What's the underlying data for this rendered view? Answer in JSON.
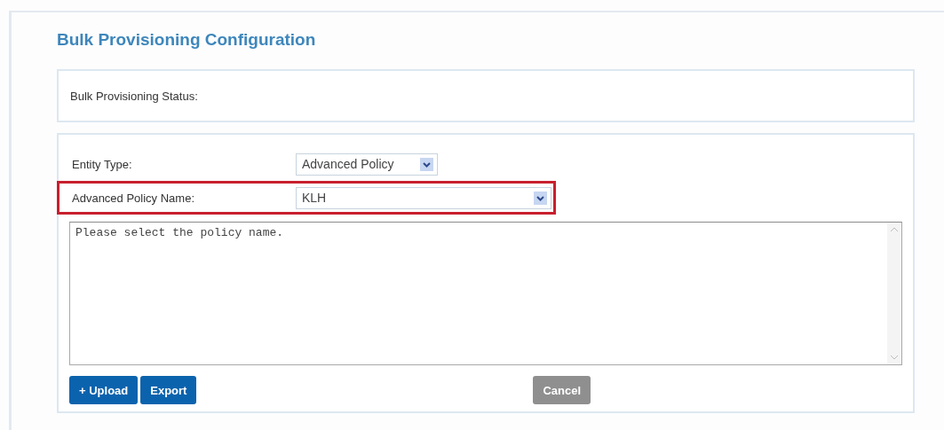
{
  "title": "Bulk Provisioning Configuration",
  "status": {
    "label": "Bulk Provisioning Status:"
  },
  "fields": [
    {
      "label": "Entity Type:",
      "value": "Advanced Policy",
      "highlighted": false
    },
    {
      "label": "Advanced Policy Name:",
      "value": "KLH",
      "highlighted": true
    }
  ],
  "message": {
    "value": "Please select the policy name."
  },
  "buttons": [
    {
      "label": "Upload",
      "icon": "+",
      "disabled": false
    },
    {
      "label": "Export",
      "disabled": false
    }
  ],
  "cancel_button": {
    "label": "Cancel",
    "disabled": true
  }
}
